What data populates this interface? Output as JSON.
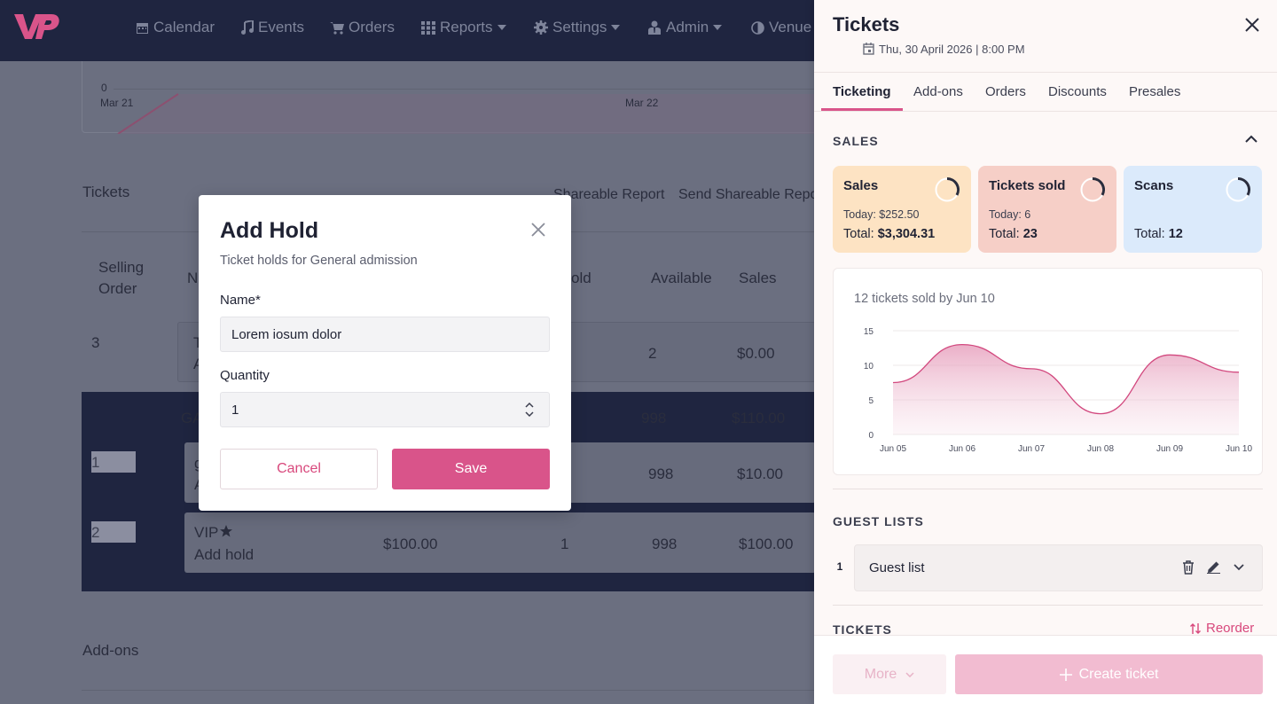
{
  "nav": {
    "items": [
      {
        "label": "Calendar",
        "icon": "calendar-icon"
      },
      {
        "label": "Events",
        "icon": "music-icon"
      },
      {
        "label": "Orders",
        "icon": "cart-icon"
      },
      {
        "label": "Reports",
        "icon": "grid-icon"
      },
      {
        "label": "Settings",
        "icon": "gear-icon"
      },
      {
        "label": "Admin",
        "icon": "user-tie-icon"
      },
      {
        "label": "Venue",
        "icon": "contrast-icon"
      }
    ]
  },
  "background": {
    "chart_axis": {
      "zero": "0",
      "x1": "Mar 21",
      "x2": "Mar 22"
    },
    "tickets_title": "Tickets",
    "shareable_report": "Shareable Report",
    "send_shareable_report": "Send Shareable Repo",
    "table_headers": {
      "selling": "Selling",
      "order": "Order",
      "name": "N",
      "sold": "old",
      "available": "Available",
      "sales": "Sales"
    },
    "row1": {
      "order": "3",
      "name1": "T",
      "name2": "A",
      "available": "2",
      "sales": "$0.00"
    },
    "ga_row": {
      "label": "GA",
      "available": "998",
      "sales": "$110.00"
    },
    "row2": {
      "order": "1",
      "name1": "g",
      "name2": "A",
      "available": "998",
      "sales": "$10.00"
    },
    "row3": {
      "order": "2",
      "name": "VIP",
      "hold": "Add hold",
      "price": "$100.00",
      "sold": "1",
      "available": "998",
      "sales": "$100.00"
    },
    "addons_title": "Add-ons"
  },
  "modal": {
    "title": "Add Hold",
    "subtitle": "Ticket holds for General admission",
    "name_label": "Name*",
    "name_value": "Lorem iosum dolor",
    "quantity_label": "Quantity",
    "quantity_value": "1",
    "cancel_label": "Cancel",
    "save_label": "Save"
  },
  "panel": {
    "title": "Tickets",
    "date": "Thu, 30 April 2026 | 8:00 PM",
    "tabs": [
      "Ticketing",
      "Add-ons",
      "Orders",
      "Discounts",
      "Presales"
    ],
    "sales_section": "SALES",
    "stats": [
      {
        "title": "Sales",
        "today": "Today: $252.50",
        "total_label": "Total: ",
        "total_value": "$3,304.31",
        "color": "#fde3c3"
      },
      {
        "title": "Tickets sold",
        "today": "Today: 6",
        "total_label": "Total: ",
        "total_value": "23",
        "color": "#f6cfc7"
      },
      {
        "title": "Scans",
        "today": "",
        "total_label": "Total: ",
        "total_value": "12",
        "color": "#dbeafb"
      }
    ],
    "chart_caption": "12 tickets sold by Jun 10",
    "guest_lists_section": "GUEST LISTS",
    "guest_list": {
      "number": "1",
      "label": "Guest list"
    },
    "tickets_section": "TICKETS",
    "reorder_label": "Reorder",
    "more_label": "More",
    "create_label": "Create ticket"
  },
  "colors": {
    "accent": "#d9548a",
    "nav_bg": "#1f2540",
    "panel_bg": "#fdf8f7"
  },
  "chart_data": {
    "type": "area",
    "x": [
      "Jun 05",
      "Jun 06",
      "Jun 07",
      "Jun 08",
      "Jun 09",
      "Jun 10"
    ],
    "values": [
      7.5,
      13,
      9.5,
      3,
      11.5,
      9
    ],
    "yticks": [
      0,
      5,
      10,
      15
    ],
    "ylim": [
      0,
      15
    ],
    "grid": true
  }
}
